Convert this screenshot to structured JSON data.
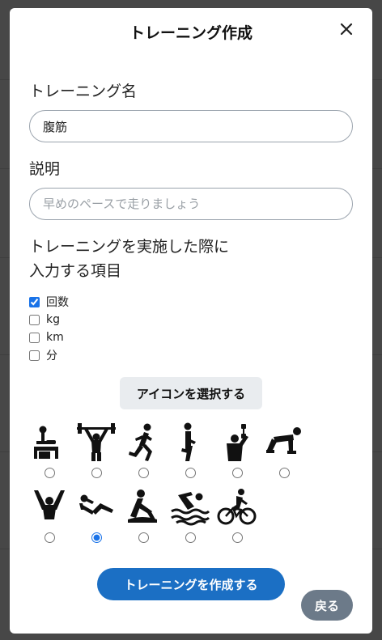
{
  "modal": {
    "title": "トレーニング作成",
    "close_icon": "close-icon"
  },
  "form": {
    "name_label": "トレーニング名",
    "name_value": "腹筋",
    "description_label": "説明",
    "description_placeholder": "早めのペースで走りましょう",
    "description_value": "",
    "inputs_label_line1": "トレーニングを実施した際に",
    "inputs_label_line2": "入力する項目",
    "input_items": [
      {
        "label": "回数",
        "checked": true
      },
      {
        "label": "kg",
        "checked": false
      },
      {
        "label": "km",
        "checked": false
      },
      {
        "label": "分",
        "checked": false
      }
    ],
    "icon_select_label": "アイコンを選択する",
    "icons": [
      {
        "name": "bench-press-icon",
        "selected": false
      },
      {
        "name": "weightlifting-icon",
        "selected": false
      },
      {
        "name": "running-icon",
        "selected": false
      },
      {
        "name": "leg-stretch-icon",
        "selected": false
      },
      {
        "name": "dumbbell-curl-icon",
        "selected": false
      },
      {
        "name": "plank-icon",
        "selected": false
      },
      {
        "name": "arms-up-icon",
        "selected": false
      },
      {
        "name": "situp-icon",
        "selected": true
      },
      {
        "name": "rowing-icon",
        "selected": false
      },
      {
        "name": "swimming-icon",
        "selected": false
      },
      {
        "name": "cycling-icon",
        "selected": false
      }
    ],
    "create_button": "トレーニングを作成する",
    "back_button": "戻る"
  },
  "colors": {
    "primary": "#1b6fc4",
    "secondary": "#6c7a89",
    "light_button": "#e9ecef"
  }
}
